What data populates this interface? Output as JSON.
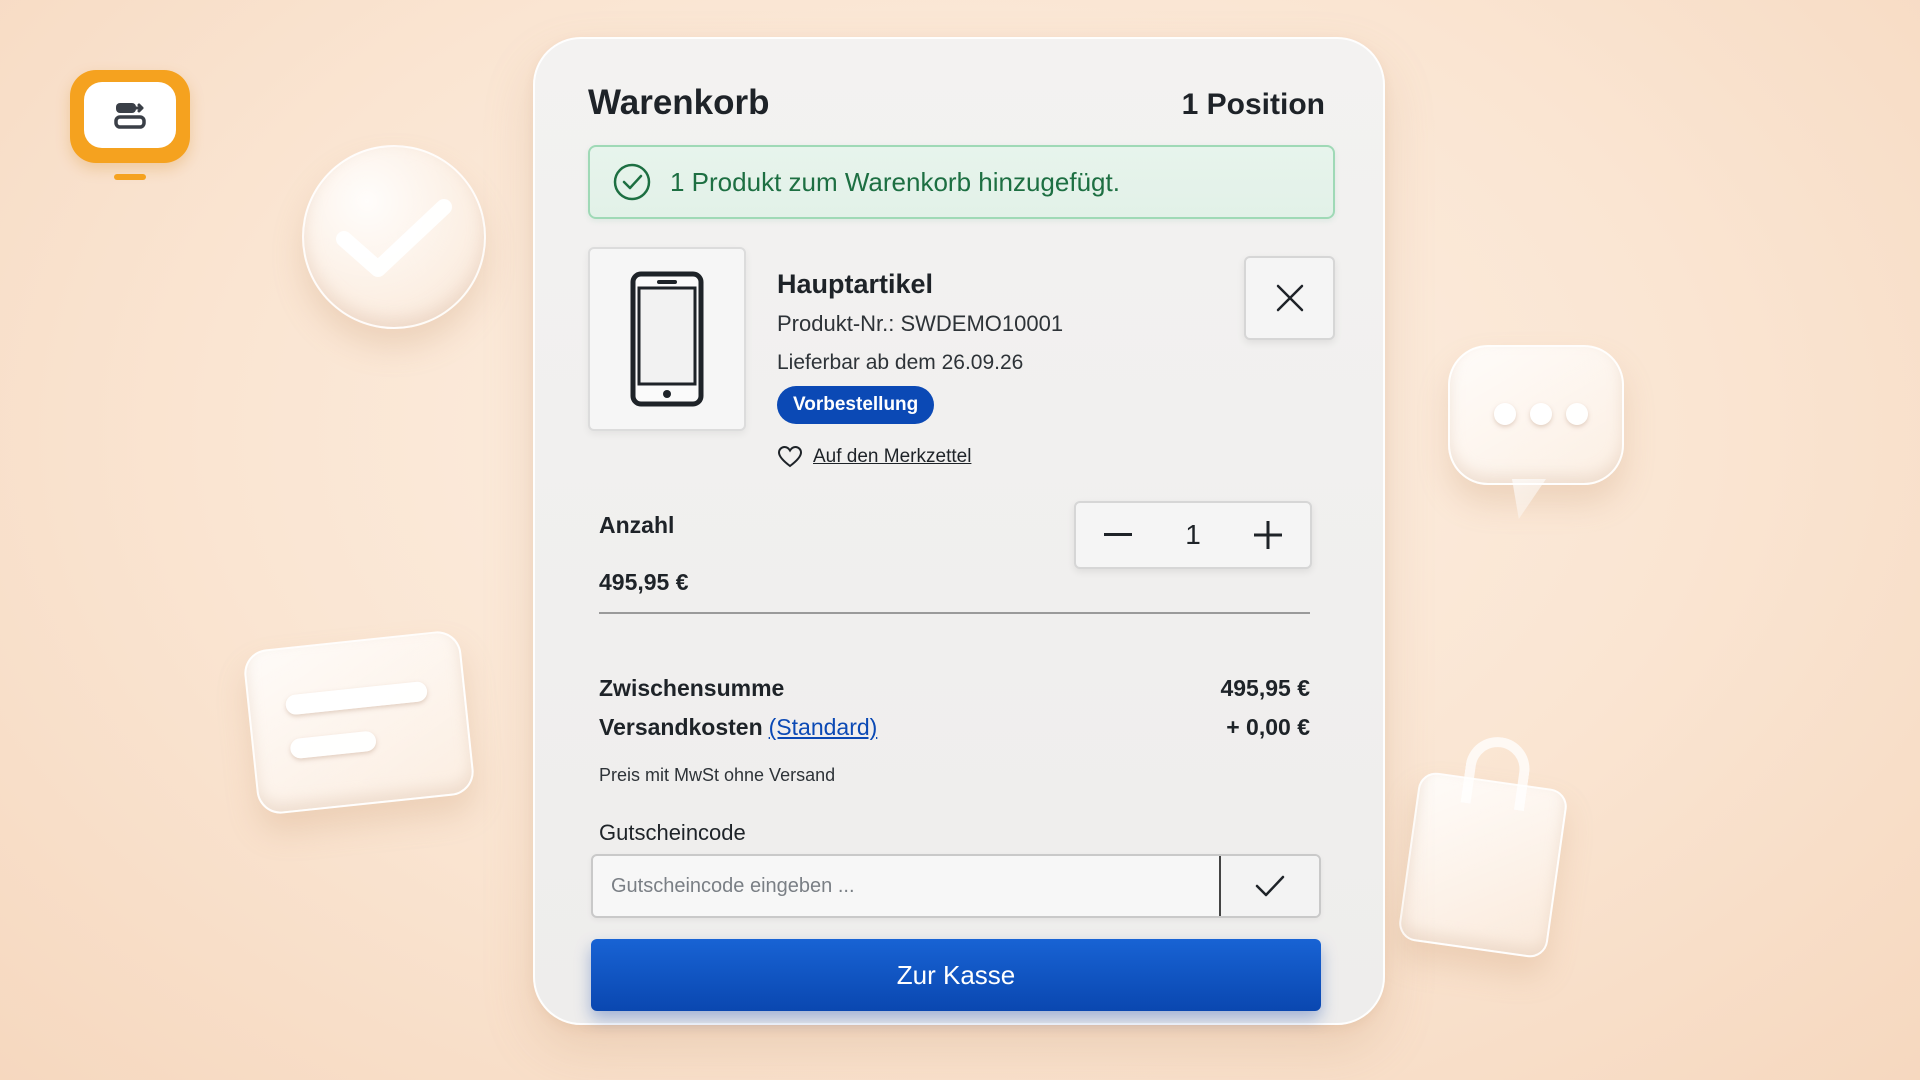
{
  "cart": {
    "title": "Warenkorb",
    "count": "1 Position",
    "alert": {
      "message": "1 Produkt zum Warenkorb hinzugefügt.",
      "color": "#1d6f42"
    },
    "item": {
      "name": "Hauptartikel",
      "sku": "Produkt-Nr.: SWDEMO10001",
      "delivery": "Lieferbar ab dem 26.09.26",
      "badge": "Vorbestellung",
      "wishlist_label": "Auf den Merkzettel",
      "image_icon": "smartphone-icon",
      "remove_icon": "close-icon"
    },
    "quantity": {
      "label": "Anzahl",
      "value": "1",
      "price": "495,95 €"
    },
    "summary": {
      "subtotal_label": "Zwischensumme",
      "subtotal_value": "495,95 €",
      "shipping_label": "Versandkosten",
      "shipping_link": "(Standard)",
      "shipping_value": "+ 0,00 €",
      "tax_note": "Preis mit MwSt ohne Versand"
    },
    "voucher": {
      "label": "Gutscheincode",
      "placeholder": "Gutscheincode eingeben ..."
    },
    "checkout_label": "Zur Kasse"
  },
  "colors": {
    "accent": "#0b49b5",
    "brand_logo": "#f5a21f",
    "success": "#1d6f42"
  }
}
